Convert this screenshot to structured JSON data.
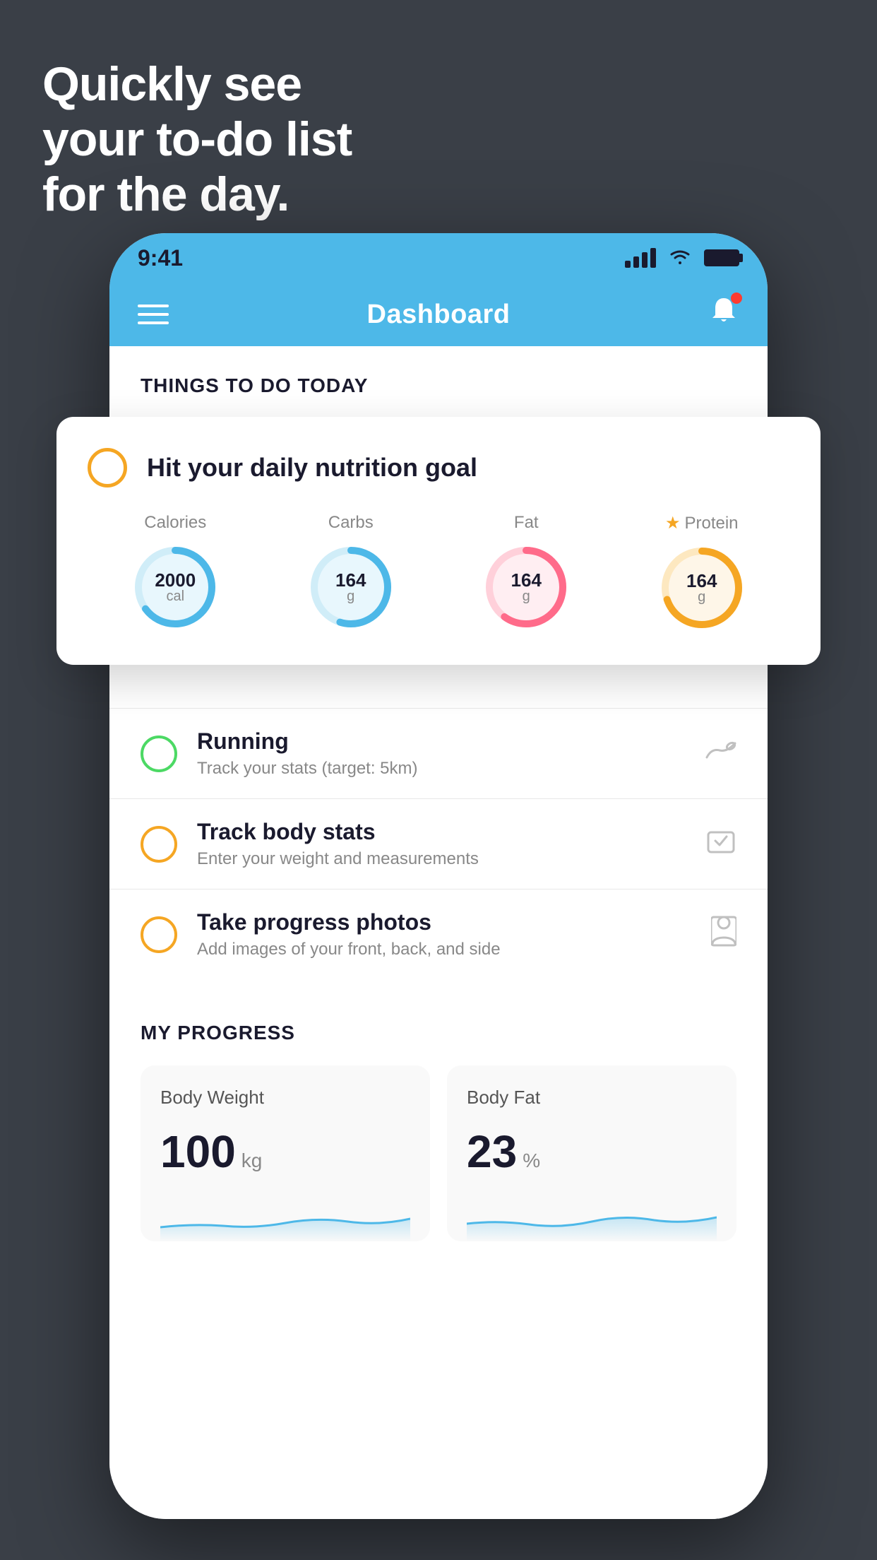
{
  "hero": {
    "line1": "Quickly see",
    "line2": "your to-do list",
    "line3": "for the day."
  },
  "statusBar": {
    "time": "9:41",
    "signalBars": [
      10,
      16,
      22,
      28
    ],
    "icons": [
      "signal",
      "wifi",
      "battery"
    ]
  },
  "navBar": {
    "title": "Dashboard",
    "menuIcon": "hamburger",
    "bellIcon": "bell"
  },
  "sectionHeader": "THINGS TO DO TODAY",
  "floatingCard": {
    "checkColor": "#f5a623",
    "title": "Hit your daily nutrition goal",
    "nutrition": [
      {
        "label": "Calories",
        "value": "2000",
        "unit": "cal",
        "color": "#4db8e8",
        "bgColor": "#e8f7fd",
        "percent": 65,
        "starred": false
      },
      {
        "label": "Carbs",
        "value": "164",
        "unit": "g",
        "color": "#4db8e8",
        "bgColor": "#e8f7fd",
        "percent": 55,
        "starred": false
      },
      {
        "label": "Fat",
        "value": "164",
        "unit": "g",
        "color": "#ff6b8a",
        "bgColor": "#ffeef2",
        "percent": 60,
        "starred": false
      },
      {
        "label": "Protein",
        "value": "164",
        "unit": "g",
        "color": "#f5a623",
        "bgColor": "#fef6e8",
        "percent": 70,
        "starred": true
      }
    ]
  },
  "listItems": [
    {
      "id": "running",
      "circleColor": "green",
      "title": "Running",
      "subtitle": "Track your stats (target: 5km)",
      "icon": "👟"
    },
    {
      "id": "body-stats",
      "circleColor": "yellow",
      "title": "Track body stats",
      "subtitle": "Enter your weight and measurements",
      "icon": "⚖️"
    },
    {
      "id": "photos",
      "circleColor": "yellow",
      "title": "Take progress photos",
      "subtitle": "Add images of your front, back, and side",
      "icon": "👤"
    }
  ],
  "progressSection": {
    "header": "MY PROGRESS",
    "cards": [
      {
        "id": "body-weight",
        "title": "Body Weight",
        "value": "100",
        "unit": "kg",
        "chartColor": "#4db8e8"
      },
      {
        "id": "body-fat",
        "title": "Body Fat",
        "value": "23",
        "unit": "%",
        "chartColor": "#4db8e8"
      }
    ]
  }
}
